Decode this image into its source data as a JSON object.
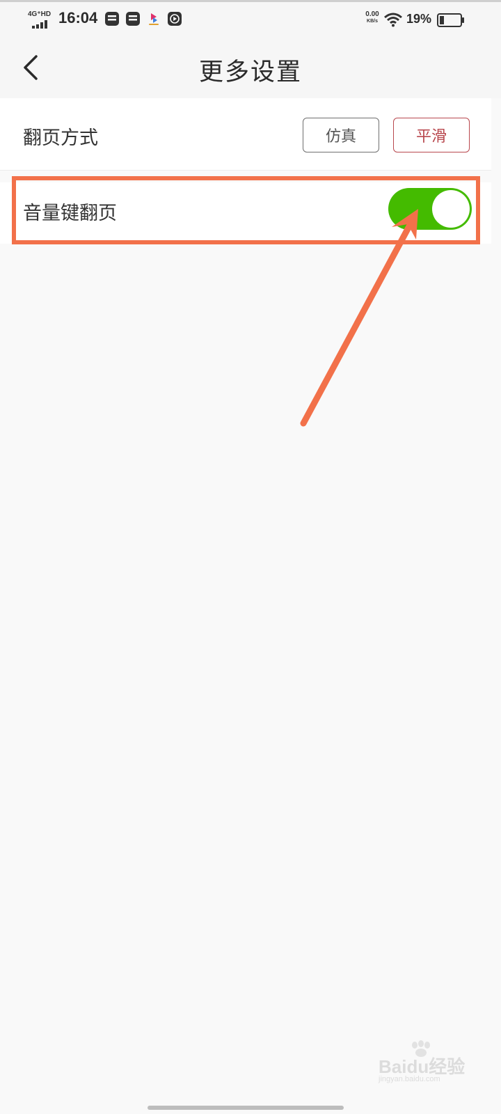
{
  "status_bar": {
    "network": "4G⁺HD",
    "time": "16:04",
    "speed_value": "0.00",
    "speed_unit": "KB/s",
    "battery_percent": "19%"
  },
  "header": {
    "title": "更多设置"
  },
  "settings": {
    "flip_mode": {
      "label": "翻页方式",
      "options": [
        "仿真",
        "平滑"
      ],
      "selected": "平滑"
    },
    "volume_key_flip": {
      "label": "音量键翻页",
      "enabled": true
    }
  },
  "colors": {
    "toggle_on": "#44bb00",
    "selected_option": "#b8474d",
    "annotation": "#f2714a"
  },
  "watermark": {
    "text": "Baidu经验",
    "sub": "jingyan.baidu.com"
  }
}
